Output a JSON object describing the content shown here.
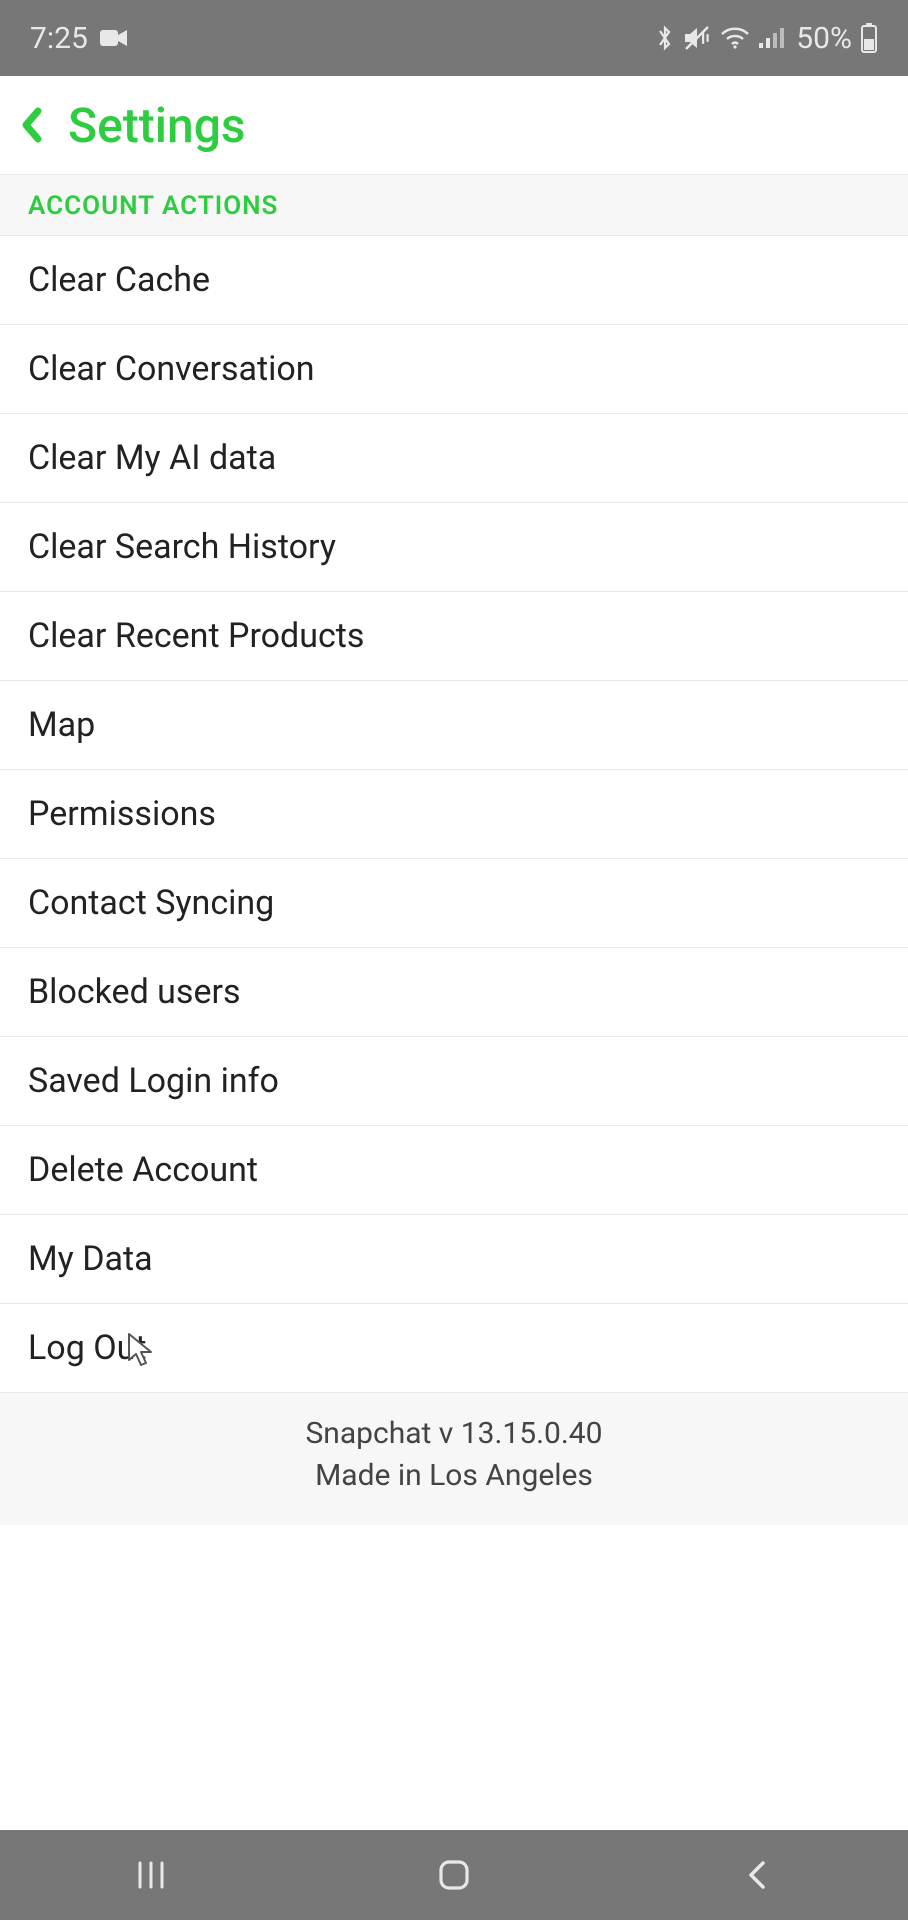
{
  "statusBar": {
    "time": "7:25",
    "batteryText": "50%"
  },
  "header": {
    "title": "Settings"
  },
  "section": {
    "label": "ACCOUNT ACTIONS"
  },
  "items": [
    {
      "label": "Clear Cache"
    },
    {
      "label": "Clear Conversation"
    },
    {
      "label": "Clear My AI data"
    },
    {
      "label": "Clear Search History"
    },
    {
      "label": "Clear Recent Products"
    },
    {
      "label": "Map"
    },
    {
      "label": "Permissions"
    },
    {
      "label": "Contact Syncing"
    },
    {
      "label": "Blocked users"
    },
    {
      "label": "Saved Login info"
    },
    {
      "label": "Delete Account"
    },
    {
      "label": "My Data"
    },
    {
      "label": "Log Out"
    }
  ],
  "footer": {
    "line1": "Snapchat v 13.15.0.40",
    "line2": "Made in Los Angeles"
  }
}
